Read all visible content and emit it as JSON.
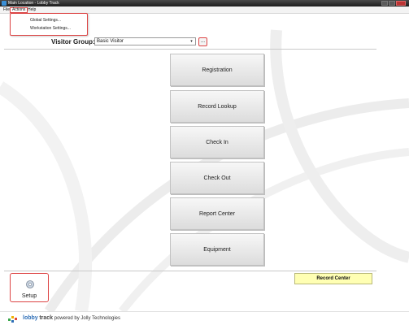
{
  "window": {
    "title": "Main Location - Lobby Track",
    "controls": [
      "minimize",
      "maximize",
      "close"
    ]
  },
  "menu": {
    "items": [
      "File",
      "Actions",
      "Help"
    ],
    "actions_dropdown": [
      "Global Settings...",
      "Workstation Settings..."
    ]
  },
  "visitor_group": {
    "label": "Visitor Group:",
    "selected": "Basic Visitor",
    "more_button": "..."
  },
  "buttons": [
    "Registration",
    "Record Lookup",
    "Check In",
    "Check Out",
    "Report Center",
    "Equipment"
  ],
  "record_center": "Record Center",
  "setup": {
    "label": "Setup"
  },
  "footer": {
    "brand_lobby": "lobby",
    "brand_track": "track",
    "tagline": "powered by Jolly Technologies"
  },
  "colors": {
    "highlight": "#dd4444",
    "record_center_bg": "#ffffb3",
    "brand_blue": "#2f6fb7"
  },
  "icons": [
    "app-icon",
    "setup-icon",
    "lobby-track-logo-icon",
    "chevron-down-icon"
  ]
}
